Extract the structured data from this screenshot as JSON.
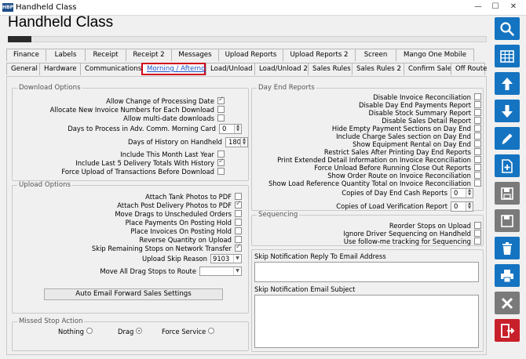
{
  "window": {
    "title": "Handheld Class",
    "app_icon_text": "HBP"
  },
  "header": {
    "title": "Handheld Class"
  },
  "tabs_row1": [
    "Finance",
    "Labels",
    "Receipt",
    "Receipt 2",
    "Messages",
    "Upload Reports",
    "Upload Reports 2",
    "Screen",
    "Mango One Mobile"
  ],
  "tabs_row2": [
    "General",
    "Hardware",
    "Communications",
    "Morning / Afternoon",
    "Load/Unload",
    "Load/Unload 2",
    "Sales Rules",
    "Sales Rules 2",
    "Confirm Sale",
    "Off Route"
  ],
  "active_tab": "Morning / Afternoon",
  "download_options": {
    "title": "Download Options",
    "allow_change_processing_date": "Allow Change of Processing Date",
    "allocate_invoice_numbers": "Allocate New Invoice Numbers for Each Download",
    "allow_multi_date": "Allow multi-date downloads",
    "days_adv_comm": "Days to Process in Adv. Comm. Morning Card",
    "days_adv_comm_value": "0",
    "days_history": "Days of History on Handheld",
    "days_history_value": "180",
    "include_month_last_year": "Include This Month Last Year",
    "include_last5": "Include Last 5 Delivery Totals With History",
    "force_upload": "Force Upload of Transactions Before Download"
  },
  "upload_options": {
    "title": "Upload Options",
    "attach_tank_photos": "Attach Tank Photos to PDF",
    "attach_post_delivery": "Attach Post Delivery Photos to PDF",
    "move_drags": "Move Drags to Unscheduled Orders",
    "place_payments": "Place Payments On Posting Hold",
    "place_invoices": "Place Invoices On Posting Hold",
    "reverse_quantity": "Reverse Quantity on Upload",
    "skip_remaining": "Skip Remaining Stops on Network Transfer",
    "upload_skip_reason": "Upload Skip Reason",
    "upload_skip_reason_value": "9103",
    "move_all_drag": "Move All Drag Stops to Route",
    "move_all_drag_value": "",
    "auto_email_button": "Auto Email Forward Sales Settings"
  },
  "missed_stop": {
    "title": "Missed Stop Action",
    "nothing": "Nothing",
    "drag": "Drag",
    "force_service": "Force Service"
  },
  "day_end": {
    "title": "Day End Reports",
    "items": [
      "Disable Invoice Reconciliation",
      "Disable Day End Payments Report",
      "Disable Stock Summary Report",
      "Disable Sales Detail Report",
      "Hide Empty Payment Sections on Day End",
      "Include Charge Sales section on Day End",
      "Show Equipment Rental on Day End",
      "Restrict Sales After Printing Day End Reports",
      "Print Extended Detail Information on Invoice Reconciliation",
      "Force Unload Before Running Close Out Reports",
      "Show Order Route on Invoice Reconciliation",
      "Show Load Reference Quantity Total on Invoice Reconciliation"
    ],
    "copies_cash": "Copies of Day End Cash Reports",
    "copies_cash_value": "0",
    "copies_load": "Copies of Load Verification Report",
    "copies_load_value": "0"
  },
  "sequencing": {
    "title": "Sequencing",
    "reorder": "Reorder Stops on Upload",
    "ignore_driver": "Ignore Driver Sequencing on Handheld",
    "use_follow_me": "Use follow-me tracking for Sequencing"
  },
  "skip_reply_label": "Skip Notification Reply To Email Address",
  "skip_reply_value": "",
  "skip_subject_label": "Skip Notification Email Subject",
  "skip_subject_value": "",
  "colors": {
    "accent": "#1574c1",
    "active_tab_border": "#d0021b",
    "danger": "#c8202a",
    "neutral_button": "#7a7a7a"
  }
}
